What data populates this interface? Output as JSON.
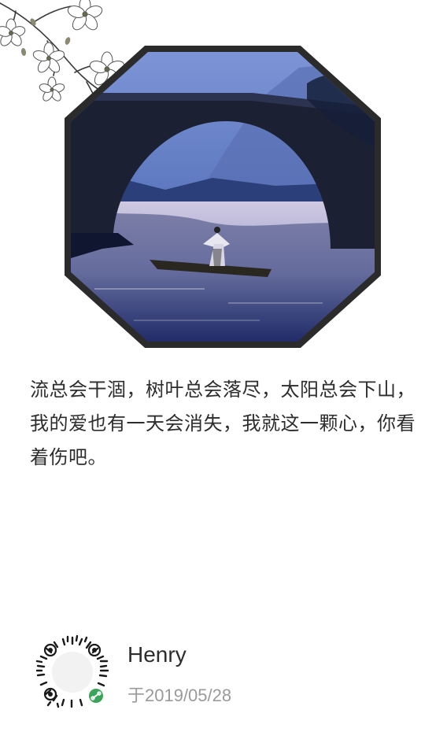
{
  "poem": {
    "text": "流总会干涸，树叶总会落尽，太阳总会下山，我的爱也有一天会消失，我就这一颗心，你看着伤吧。"
  },
  "author": {
    "name": "Henry",
    "date": "于2019/05/28"
  },
  "icons": {
    "blossom": "blossom-branch-icon",
    "qrcode": "mini-program-code-icon",
    "badge": "link-badge-icon"
  },
  "colors": {
    "frame": "#2b2b2b",
    "text": "#2d2d2d",
    "muted": "#9a9a9a",
    "badge": "#3aa55a"
  }
}
